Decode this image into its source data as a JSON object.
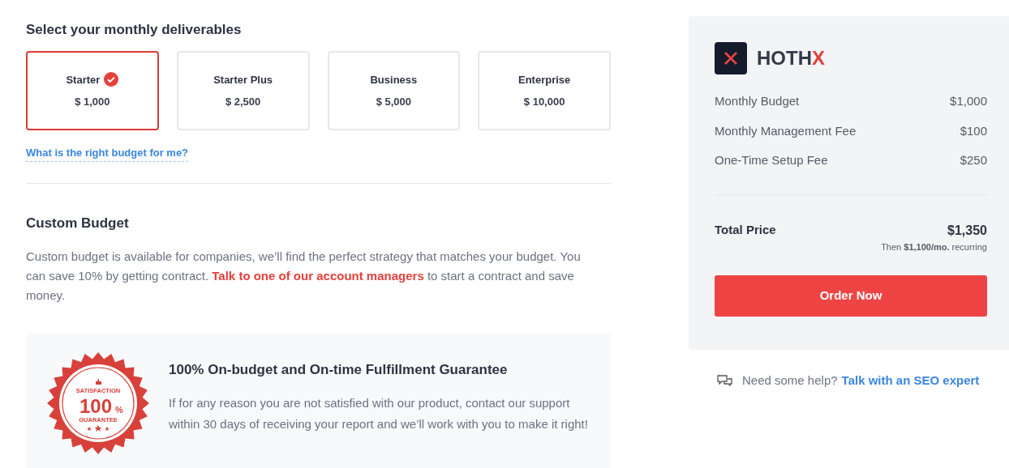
{
  "deliverables": {
    "heading": "Select your monthly deliverables",
    "plans": [
      {
        "name": "Starter",
        "price": "$ 1,000",
        "selected": true
      },
      {
        "name": "Starter Plus",
        "price": "$ 2,500",
        "selected": false
      },
      {
        "name": "Business",
        "price": "$ 5,000",
        "selected": false
      },
      {
        "name": "Enterprise",
        "price": "$ 10,000",
        "selected": false
      }
    ],
    "help_link": "What is the right budget for me?"
  },
  "custom_budget": {
    "heading": "Custom Budget",
    "text_before": "Custom budget is available for companies, we’ll find the perfect strategy that matches your budget. You can save 10% by getting contract.",
    "link": "Talk to one of our account managers",
    "text_after": "to start a contract and save money."
  },
  "guarantee": {
    "badge": {
      "top": "SATISFACTION",
      "big": "100",
      "percent": "%",
      "bottom": "GUARANTEE"
    },
    "title": "100% On-budget and On-time Fulfillment Guarantee",
    "text": "If for any reason you are not satisfied with our product, contact our support within 30 days of receiving your report and we’ll work with you to make it right!"
  },
  "summary": {
    "logo": {
      "text": "HOTH",
      "accent": "X"
    },
    "rows": [
      {
        "label": "Monthly Budget",
        "value": "$1,000"
      },
      {
        "label": "Monthly Management Fee",
        "value": "$100"
      },
      {
        "label": "One-Time Setup Fee",
        "value": "$250"
      }
    ],
    "total": {
      "label": "Total Price",
      "value": "$1,350",
      "note": "Then **$1,100/mo.** recurring"
    },
    "button": "Order Now"
  },
  "help": {
    "text": "Need some help?",
    "link": "Talk with an SEO expert"
  }
}
